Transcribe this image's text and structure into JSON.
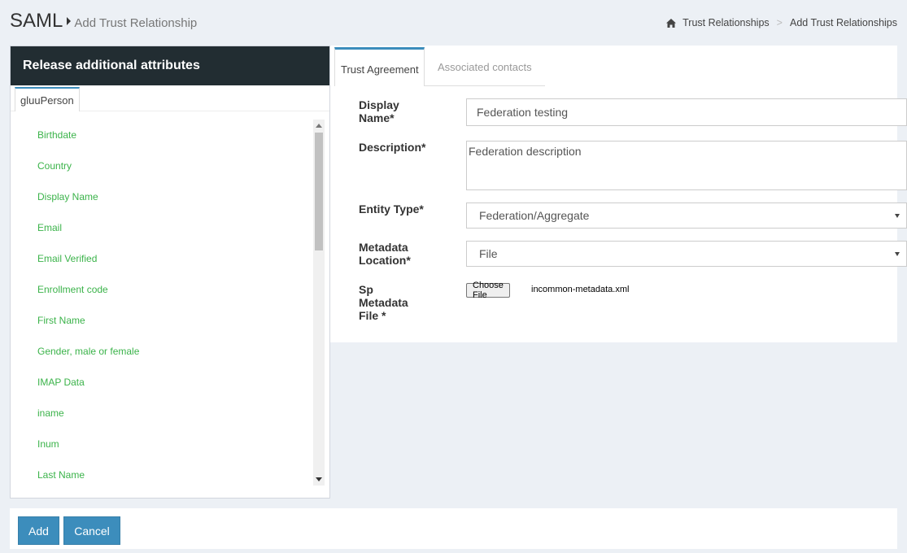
{
  "header": {
    "title": "SAML",
    "subtitle": "Add Trust Relationship"
  },
  "breadcrumb": {
    "home_icon": "home-icon",
    "items": [
      "Trust Relationships",
      "Add Trust Relationships"
    ],
    "separator": ">"
  },
  "attributes_panel": {
    "title": "Release additional attributes",
    "tab": "gluuPerson",
    "items": [
      "Birthdate",
      "Country",
      "Display Name",
      "Email",
      "Email Verified",
      "Enrollment code",
      "First Name",
      "Gender, male or female",
      "IMAP Data",
      "iname",
      "Inum",
      "Last Name"
    ]
  },
  "tabs": {
    "active": "Trust Agreement",
    "inactive": "Associated contacts"
  },
  "form": {
    "display_name_label": "Display Name*",
    "display_name_value": "Federation testing",
    "description_label": "Description*",
    "description_value": "Federation description",
    "entity_type_label": "Entity Type*",
    "entity_type_value": "Federation/Aggregate",
    "metadata_location_label": "Metadata Location*",
    "metadata_location_value": "File",
    "sp_metadata_label": "Sp Metadata File *",
    "choose_file_label": "Choose File",
    "file_name": "incommon-metadata.xml"
  },
  "footer": {
    "add_label": "Add",
    "cancel_label": "Cancel"
  },
  "colors": {
    "accent": "#3c8dbc",
    "panel_header": "#222d32",
    "attribute_text": "#3bb34a",
    "page_background": "#ecf0f5"
  }
}
